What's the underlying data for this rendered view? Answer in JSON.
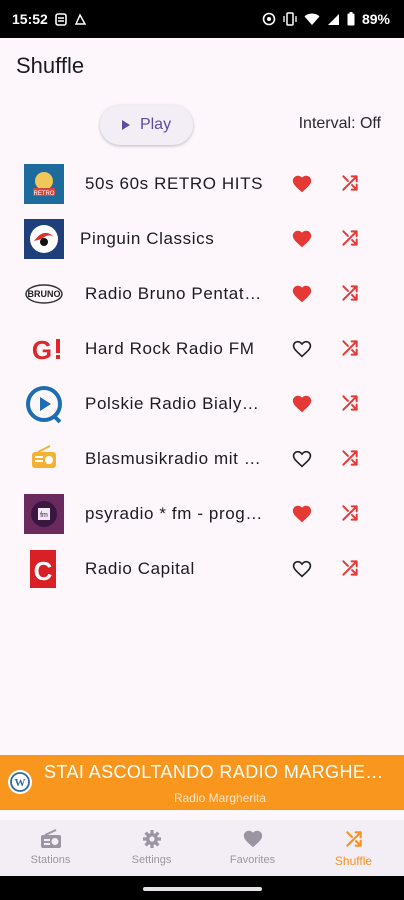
{
  "status_bar": {
    "time": "15:52",
    "battery": "89%"
  },
  "header": {
    "title": "Shuffle"
  },
  "controls": {
    "play_label": "Play",
    "interval_label": "Interval: Off"
  },
  "stations": [
    {
      "name": "50s 60s RETRO HITS",
      "favorite": true,
      "logo": "retro-hits-logo"
    },
    {
      "name": "Pinguin Classics",
      "favorite": true,
      "logo": "pinguin-logo"
    },
    {
      "name": "Radio Bruno Pentatlon",
      "favorite": true,
      "logo": "radio-bruno-logo"
    },
    {
      "name": "Hard Rock Radio FM",
      "favorite": false,
      "logo": "g-logo"
    },
    {
      "name": "Polskie Radio Bialystok",
      "favorite": true,
      "logo": "polskie-radio-logo"
    },
    {
      "name": "Blasmusikradio mit Herz",
      "favorite": false,
      "logo": "radio-icon-logo"
    },
    {
      "name": "psyradio * fm - progressive",
      "favorite": true,
      "logo": "psyradio-logo"
    },
    {
      "name": "Radio Capital",
      "favorite": false,
      "logo": "capital-logo"
    }
  ],
  "now_playing": {
    "title": "STAI ASCOLTANDO RADIO MARGHERITA",
    "subtitle": "Radio Margherita"
  },
  "nav": {
    "items": [
      {
        "label": "Stations",
        "icon": "radio-icon",
        "active": false
      },
      {
        "label": "Settings",
        "icon": "gear-icon",
        "active": false
      },
      {
        "label": "Favorites",
        "icon": "heart-icon",
        "active": false
      },
      {
        "label": "Shuffle",
        "icon": "shuffle-icon",
        "active": true
      }
    ]
  },
  "colors": {
    "accent": "#f49424",
    "heart": "#e53935",
    "now_playing_bg": "#f9961d"
  }
}
